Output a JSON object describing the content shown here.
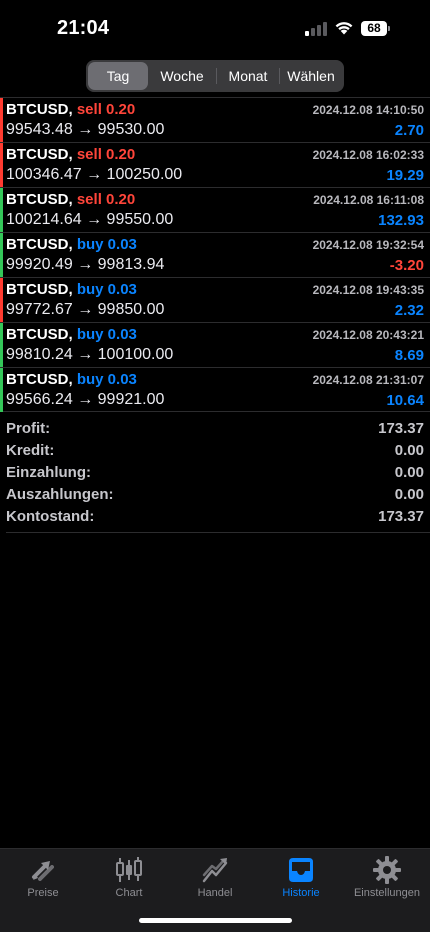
{
  "status_bar": {
    "time": "21:04",
    "battery": "68"
  },
  "segments": [
    {
      "label": "Tag",
      "active": true
    },
    {
      "label": "Woche",
      "active": false
    },
    {
      "label": "Monat",
      "active": false
    },
    {
      "label": "Wählen",
      "active": false
    }
  ],
  "trades": [
    {
      "symbol": "BTCUSD,",
      "side": "sell",
      "side_label": "sell 0.20",
      "open": "99543.48",
      "arrow": "→",
      "close": "99530.00",
      "time": "2024.12.08 14:10:50",
      "profit": "2.70",
      "bar_color": "#ff3b30"
    },
    {
      "symbol": "BTCUSD,",
      "side": "sell",
      "side_label": "sell 0.20",
      "open": "100346.47",
      "arrow": "→",
      "close": "100250.00",
      "time": "2024.12.08 16:02:33",
      "profit": "19.29",
      "bar_color": "#ff3b30"
    },
    {
      "symbol": "BTCUSD,",
      "side": "sell",
      "side_label": "sell 0.20",
      "open": "100214.64",
      "arrow": "→",
      "close": "99550.00",
      "time": "2024.12.08 16:11:08",
      "profit": "132.93",
      "bar_color": "#34c759"
    },
    {
      "symbol": "BTCUSD,",
      "side": "buy",
      "side_label": "buy 0.03",
      "open": "99920.49",
      "arrow": "→",
      "close": "99813.94",
      "time": "2024.12.08 19:32:54",
      "profit": "-3.20",
      "bar_color": "#34c759"
    },
    {
      "symbol": "BTCUSD,",
      "side": "buy",
      "side_label": "buy 0.03",
      "open": "99772.67",
      "arrow": "→",
      "close": "99850.00",
      "time": "2024.12.08 19:43:35",
      "profit": "2.32",
      "bar_color": "#ff3b30"
    },
    {
      "symbol": "BTCUSD,",
      "side": "buy",
      "side_label": "buy 0.03",
      "open": "99810.24",
      "arrow": "→",
      "close": "100100.00",
      "time": "2024.12.08 20:43:21",
      "profit": "8.69",
      "bar_color": "#34c759"
    },
    {
      "symbol": "BTCUSD,",
      "side": "buy",
      "side_label": "buy 0.03",
      "open": "99566.24",
      "arrow": "→",
      "close": "99921.00",
      "time": "2024.12.08 21:31:07",
      "profit": "10.64",
      "bar_color": "#34c759"
    }
  ],
  "summary": [
    {
      "label": "Profit:",
      "value": "173.37"
    },
    {
      "label": "Kredit:",
      "value": "0.00"
    },
    {
      "label": "Einzahlung:",
      "value": "0.00"
    },
    {
      "label": "Auszahlungen:",
      "value": "0.00"
    },
    {
      "label": "Kontostand:",
      "value": "173.37"
    }
  ],
  "tabs": [
    {
      "label": "Preise",
      "icon": "quotes-arrows-icon",
      "active": false
    },
    {
      "label": "Chart",
      "icon": "candlestick-chart-icon",
      "active": false
    },
    {
      "label": "Handel",
      "icon": "trade-trend-icon",
      "active": false
    },
    {
      "label": "Historie",
      "icon": "inbox-tray-icon",
      "active": true
    },
    {
      "label": "Einstellungen",
      "icon": "gear-icon",
      "active": false
    }
  ],
  "colors": {
    "background": "#000000",
    "accent_blue": "#0a84ff",
    "loss_red": "#ff453a",
    "bar_red": "#ff3b30",
    "bar_green": "#34c759",
    "tab_inactive": "#8e8e93"
  }
}
